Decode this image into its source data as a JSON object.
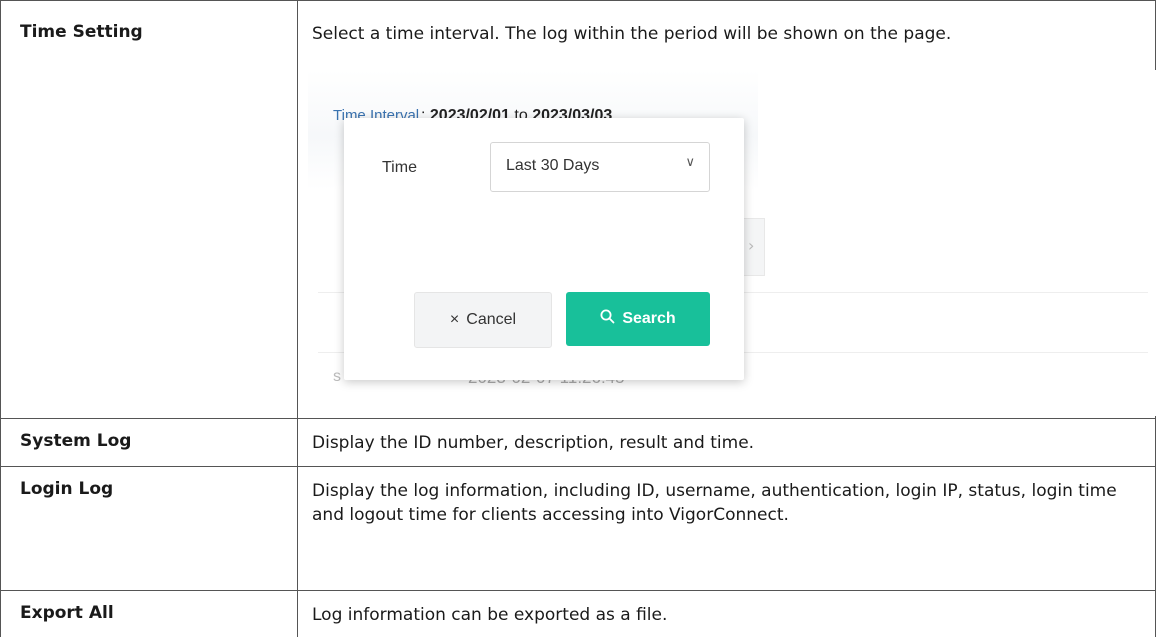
{
  "rows": [
    {
      "label": "Time Setting",
      "desc": "Select a time interval. The log within the period will be shown on the page."
    },
    {
      "label": "System Log",
      "desc": "Display the ID number, description, result and time."
    },
    {
      "label": "Login Log",
      "desc": "Display the log information, including ID, username, authentication, login IP, status, login time and logout time for clients accessing into VigorConnect."
    },
    {
      "label": "Export All",
      "desc": "Log information can be exported as a file."
    }
  ],
  "screenshot": {
    "time_interval_label": "Time Interval",
    "time_interval_sep": ": ",
    "start_date": "2023/02/01",
    "to": " to ",
    "end_date": "2023/03/03",
    "dialog": {
      "time_label": "Time",
      "select_value": "Last 30 Days",
      "cancel_label": "Cancel",
      "search_label": "Search"
    },
    "background_row": {
      "status_fragment": "s",
      "timestamp": "2023-02-07 11:26:45"
    }
  }
}
